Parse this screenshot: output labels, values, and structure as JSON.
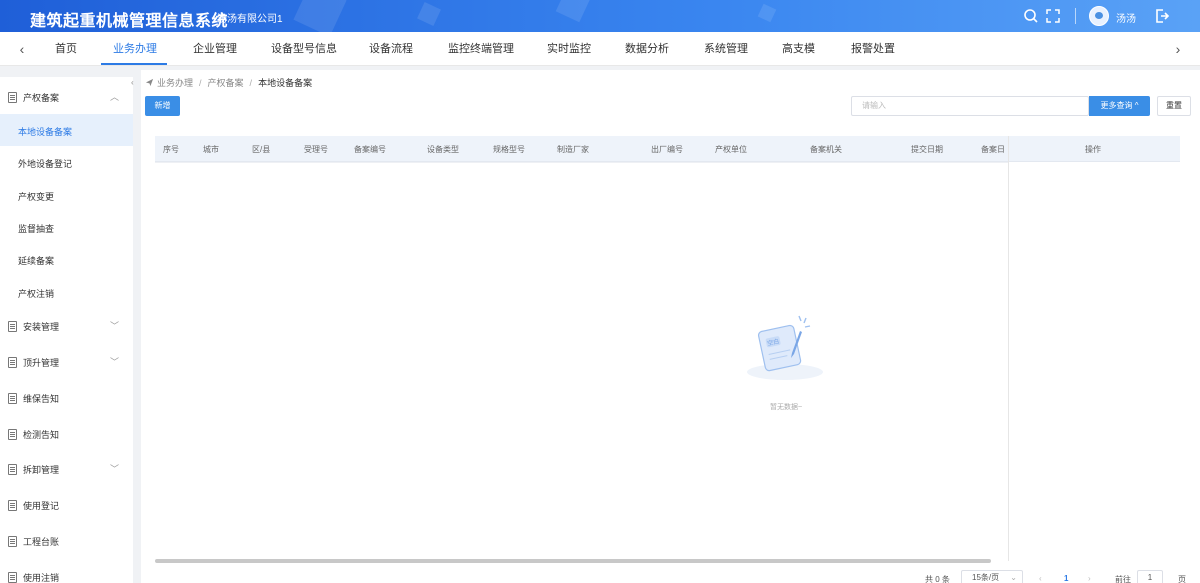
{
  "header": {
    "app_title": "建筑起重机械管理信息系统",
    "company": "汤汤有限公司1",
    "username": "汤汤",
    "icons": [
      "search-icon",
      "fullscreen-icon",
      "avatar",
      "logout-icon"
    ],
    "bg_color": "#2b6fe0"
  },
  "topnav": {
    "prev_arrow": "‹",
    "next_arrow": "›",
    "items": [
      "首页",
      "业务办理",
      "企业管理",
      "设备型号信息",
      "设备流程",
      "监控终端管理",
      "实时监控",
      "数据分析",
      "系统管理",
      "高支模",
      "报警处置"
    ],
    "active_index": 1,
    "accent_color": "#2d7be5"
  },
  "sidebar": {
    "groups": [
      {
        "label": "产权备案",
        "expanded": true,
        "sub": [
          "本地设备备案",
          "外地设备登记",
          "产权变更",
          "监督抽查",
          "延续备案",
          "产权注销"
        ],
        "active_sub": 0
      },
      {
        "label": "安装管理",
        "expanded": false
      },
      {
        "label": "顶升管理",
        "expanded": false
      },
      {
        "label": "维保告知"
      },
      {
        "label": "检测告知"
      },
      {
        "label": "拆卸管理",
        "expanded": false
      },
      {
        "label": "使用登记"
      },
      {
        "label": "工程台账"
      },
      {
        "label": "使用注销"
      }
    ]
  },
  "breadcrumb": {
    "items": [
      "业务办理",
      "产权备案"
    ],
    "current": "本地设备备案"
  },
  "toolbar": {
    "new_label": "新增",
    "search_placeholder": "请输入",
    "more_query_label": "更多查询 ^",
    "reset_label": "重置"
  },
  "table": {
    "columns": [
      "序号",
      "城市",
      "区/县",
      "受理号",
      "备案编号",
      "设备类型",
      "规格型号",
      "制造厂家",
      "出厂编号",
      "产权单位",
      "备案机关",
      "提交日期",
      "备案日",
      "操作"
    ],
    "rows": []
  },
  "empty": {
    "illus_text": "空白",
    "text": "暂无数据~"
  },
  "pagination": {
    "total_label": "共 0 条",
    "page_size_label": "15条/页",
    "current_page": "1",
    "goto_prefix": "前往",
    "goto_value": "1",
    "goto_suffix": "页"
  }
}
